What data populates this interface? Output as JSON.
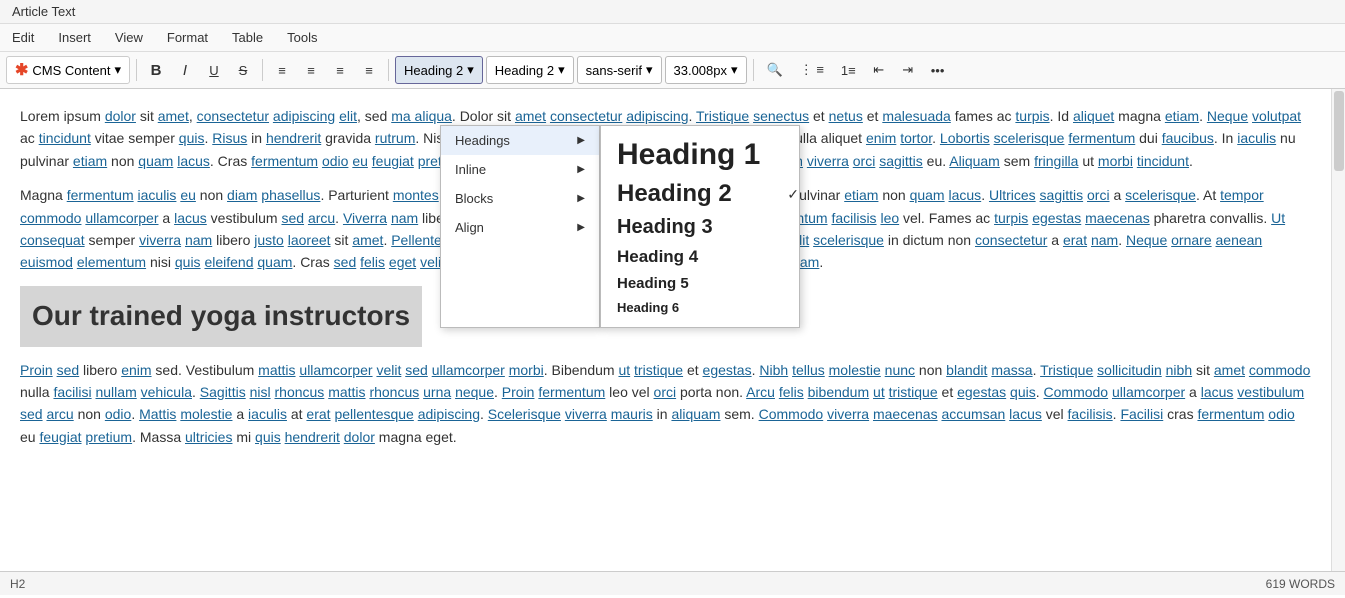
{
  "title_bar": {
    "text": "Article Text"
  },
  "menu_bar": {
    "items": [
      {
        "label": "Edit",
        "id": "edit"
      },
      {
        "label": "Insert",
        "id": "insert"
      },
      {
        "label": "View",
        "id": "view"
      },
      {
        "label": "Format",
        "id": "format"
      },
      {
        "label": "Table",
        "id": "table"
      },
      {
        "label": "Tools",
        "id": "tools"
      }
    ]
  },
  "toolbar": {
    "cms_label": "CMS Content",
    "bold_label": "B",
    "italic_label": "I",
    "underline_label": "U",
    "strikethrough_label": "S",
    "align_left": "≡",
    "align_center": "≡",
    "align_right": "≡",
    "align_justify": "≡",
    "heading_dropdown": "Heading 2",
    "heading_dropdown2": "Heading 2",
    "font_family": "sans-serif",
    "font_size": "33.008px",
    "search_icon": "🔍",
    "more_icon": "···"
  },
  "heading_menu": {
    "items": [
      {
        "label": "Headings",
        "id": "headings",
        "has_sub": true,
        "active": true
      },
      {
        "label": "Inline",
        "id": "inline",
        "has_sub": true
      },
      {
        "label": "Blocks",
        "id": "blocks",
        "has_sub": true
      },
      {
        "label": "Align",
        "id": "align",
        "has_sub": true
      }
    ],
    "headings": [
      {
        "label": "Heading 1",
        "class": "h1-option",
        "checked": false
      },
      {
        "label": "Heading 2",
        "class": "h2-option",
        "checked": true
      },
      {
        "label": "Heading 3",
        "class": "h3-option",
        "checked": false
      },
      {
        "label": "Heading 4",
        "class": "h4-option",
        "checked": false
      },
      {
        "label": "Heading 5",
        "class": "h5-option",
        "checked": false
      },
      {
        "label": "Heading 6",
        "class": "h6-option",
        "checked": false
      }
    ]
  },
  "editor": {
    "paragraph1": "Lorem ipsum dolor sit amet, consectetur adipiscing elit, sed magna aliqua. Dolor sit amet consectetur adipiscing. Tristique senectus et netus et malesuada fames ac turpis. Id aliquet magna etiam. Neque volutpat ac tincidunt vitae semper quis. Risus in hendrerit gravida rutrum. Nisl condimentum id ven ultricies mi eget mauris. Tristique nulla aliquet enim tortor. Lobortis scelerisque fermentum dui faucibus. In iaculis nu pulvinar etiam non quam lacus. Cras fermentum odio eu feugiat pretium nibh ipsum consequat. Pellentesque pulvinar pell uam viverra orci sagittis eu. Aliquam sem fringilla ut morbi tincidunt.",
    "paragraph2": "Magna fermentum iaculis eu non diam phasellus. Parturient montes nascetur n lacus vel facilisis volutpat. Quam elementum pulvinar etiam non quam lacus. Ultrices sagittis orci a scelerisque. At tempor commodo ullamcorper a lacus vestibulum sed arcu. Viverra nam libero justo laoreet sit. Dolor purus non enim praesent elementum facilisis leo vel. Fames ac turpis egestas maecenas pharetra convallis. Ut consequat semper viverra nam libero justo laoreet sit amet. Pellentesque habitant morbi tristique senectus et netus et. Erat velit scelerisque in dictum non consectetur a erat nam. Neque ornare aenean euismod elementum nisi quis eleifend quam. Cras sed felis eget velit aliquet sagittis. Euismod elementum nisi quis eleifend quam.",
    "heading": "Our trained yoga instructors",
    "paragraph3": "Proin sed libero enim sed. Vestibulum mattis ullamcorper velit sed ullamcorper morbi. Bibendum ut tristique et egestas. Nibh tellus molestie nunc non blandit massa. Tristique sollicitudin nibh sit amet commodo nulla facilisi nullam vehicula. Sagittis nisl rhoncus mattis rhoncus urna neque. Proin fermentum leo vel orci porta non. Arcu felis bibendum ut tristique et egestas quis. Commodo ullamcorper a lacus vestibulum sed arcu non odio. Mattis molestie a iaculis at erat pellentesque adipiscing. Scelerisque viverra mauris in aliquam sem. Commodo viverra maecenas accumsan lacus vel facilisis. Facilisi cras fermentum odio eu feugiat pretium. Massa ultricies mi quis hendrerit dolor magna eget."
  },
  "status_bar": {
    "path": "H2",
    "word_count": "619 WORDS"
  }
}
